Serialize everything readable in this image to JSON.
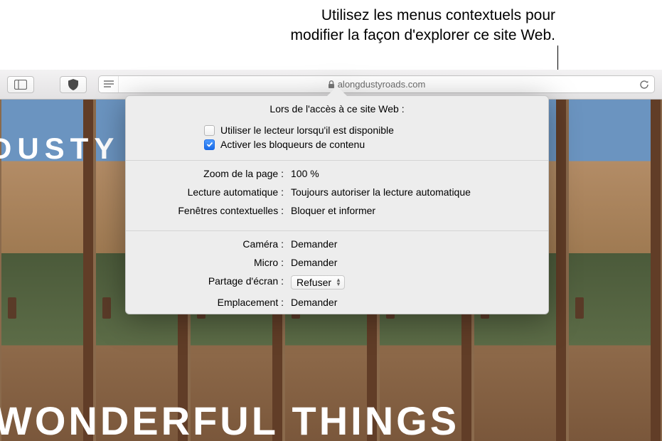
{
  "annotation": {
    "line1": "Utilisez les menus contextuels pour",
    "line2": "modifier la façon d'explorer ce site Web."
  },
  "toolbar": {
    "domain": "alongdustyroads.com"
  },
  "hero": {
    "dusty": "DUSTY",
    "bottom": "WONDERFUL THINGS"
  },
  "popover": {
    "title": "Lors de l'accès à ce site Web :",
    "use_reader_label": "Utiliser le lecteur lorsqu'il est disponible",
    "use_reader_checked": false,
    "enable_blockers_label": "Activer les bloqueurs de contenu",
    "enable_blockers_checked": true,
    "group1": {
      "zoom_label": "Zoom de la page :",
      "zoom_value": "100 %",
      "autoplay_label": "Lecture automatique :",
      "autoplay_value": "Toujours autoriser la lecture automatique",
      "popups_label": "Fenêtres contextuelles :",
      "popups_value": "Bloquer et informer"
    },
    "group2": {
      "camera_label": "Caméra :",
      "camera_value": "Demander",
      "mic_label": "Micro :",
      "mic_value": "Demander",
      "screen_label": "Partage d'écran :",
      "screen_value": "Refuser",
      "location_label": "Emplacement :",
      "location_value": "Demander"
    }
  }
}
